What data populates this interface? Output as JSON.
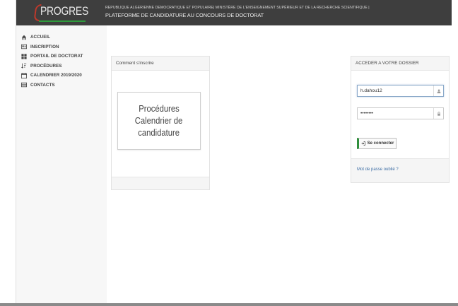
{
  "header": {
    "logo_text": "PROGRES",
    "line1": "REPUBLIQUE ALGERIENNE DEMOCRATIQUE ET POPULAIRE| MINISTÈRE DE L'ENSEIGNEMENT SUPÉRIEUR ET DE LA RECHERCHE SCIENTIFIQUE |",
    "line2": "PLATEFORME DE CANDIDATURE AU CONCOURS DE DOCTORAT"
  },
  "sidebar": {
    "items": [
      {
        "label": "ACCUEIL",
        "icon": "home-icon"
      },
      {
        "label": "INSCRIPTION",
        "icon": "id-card-icon"
      },
      {
        "label": "PORTAIL DE DOCTORAT",
        "icon": "grid-icon"
      },
      {
        "label": "PROCÉDURES",
        "icon": "sort-icon"
      },
      {
        "label": "CALENDRIER 2019/2020",
        "icon": "calendar-icon"
      },
      {
        "label": "CONTACTS",
        "icon": "contact-card-icon"
      }
    ]
  },
  "info_card": {
    "title": "Comment s'inscrire",
    "proc_line1": "Procédures",
    "proc_line2": "Calendrier de",
    "proc_line3": "candidature"
  },
  "login_card": {
    "title": "ACCEDER A VOTRE DOSSIER",
    "username_value": "h.dahou12",
    "password_value": "••••••••",
    "username_icon": "user-icon",
    "password_icon": "lock-icon",
    "login_button": "Se connecter",
    "login_button_icon": "sign-in-icon",
    "forgot_link": "Mot de passe oublié ?"
  },
  "colors": {
    "header_bg": "#3e3e3e",
    "accent_green": "#2f8f3c",
    "logo_red": "#c0392b",
    "link_blue": "#3f6fa5"
  }
}
